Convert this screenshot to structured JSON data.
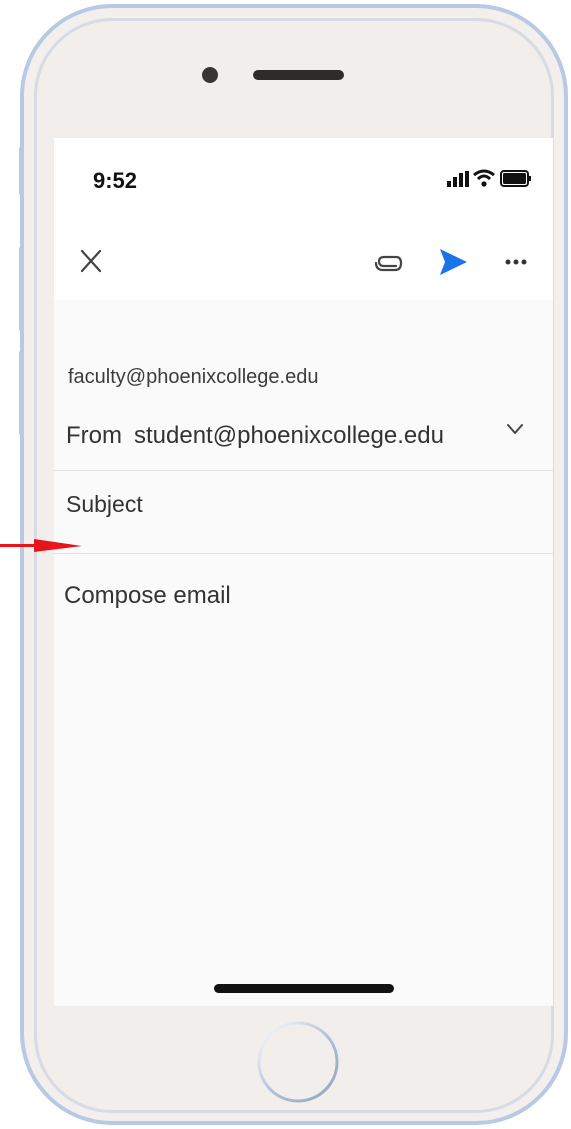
{
  "status_bar": {
    "time": "9:52"
  },
  "toolbar": {
    "close_icon": "close-icon",
    "attach_icon": "paperclip-icon",
    "send_icon": "send-icon",
    "more_icon": "more-horizontal-icon"
  },
  "compose": {
    "to": "faculty@phoenixcollege.edu",
    "from_label": "From",
    "from_value": "student@phoenixcollege.edu",
    "subject_placeholder": "Subject",
    "body_placeholder": "Compose email"
  },
  "colors": {
    "accent": "#1a73e8",
    "annotation_arrow": "#e8141b",
    "phone_frame": "#b8c9e3"
  }
}
